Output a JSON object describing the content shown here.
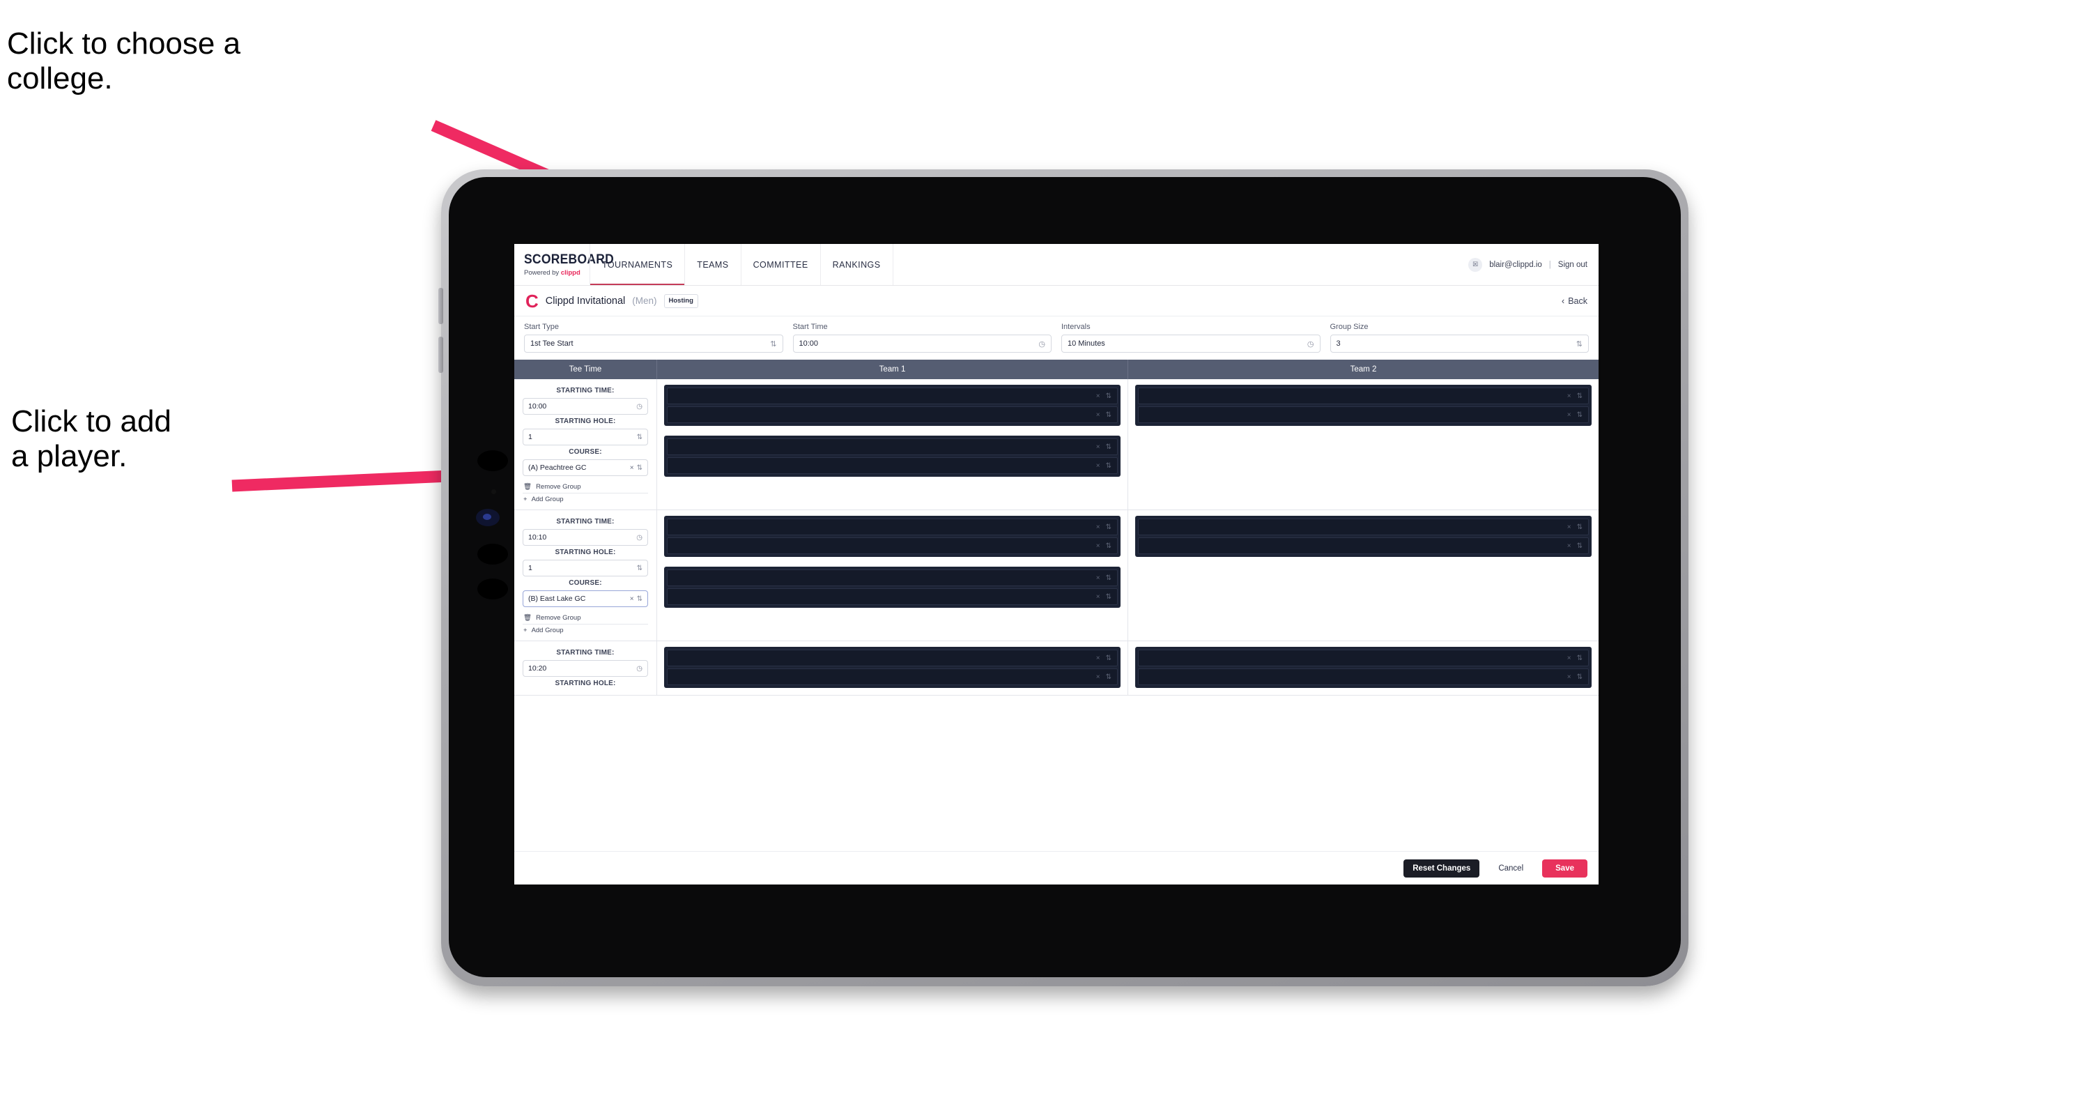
{
  "annotations": {
    "choose_college": "Click to choose a\ncollege.",
    "add_player": "Click to add\na player."
  },
  "colors": {
    "accent_pink": "#e8325c",
    "annotation_arrow": "#ef2a62",
    "table_header_bg": "#555d72",
    "panel_dark": "#1c2335"
  },
  "topnav": {
    "brand_name": "SCOREBOARD",
    "brand_sub_prefix": "Powered by ",
    "brand_sub_strong": "clippd",
    "items": [
      {
        "label": "TOURNAMENTS",
        "active": true
      },
      {
        "label": "TEAMS",
        "active": false
      },
      {
        "label": "COMMITTEE",
        "active": false
      },
      {
        "label": "RANKINGS",
        "active": false
      }
    ],
    "avatar_glyph": "☒",
    "email": "blair@clippd.io",
    "separator": "|",
    "sign_out": "Sign out"
  },
  "titlebar": {
    "logo_letter": "C",
    "tournament_name": "Clippd Invitational",
    "gender": "(Men)",
    "badge": "Hosting",
    "back_chevron": "‹",
    "back_label": "Back"
  },
  "controls": [
    {
      "label": "Start Type",
      "value": "1st Tee Start",
      "icon": "stepper-icon"
    },
    {
      "label": "Start Time",
      "value": "10:00",
      "icon": "clock-icon"
    },
    {
      "label": "Intervals",
      "value": "10 Minutes",
      "icon": "clock-icon"
    },
    {
      "label": "Group Size",
      "value": "3",
      "icon": "stepper-icon"
    }
  ],
  "table": {
    "headers": {
      "tee_time": "Tee Time",
      "team1": "Team 1",
      "team2": "Team 2"
    },
    "labels": {
      "starting_time": "STARTING TIME:",
      "starting_hole": "STARTING HOLE:",
      "course": "COURSE:",
      "remove_group": "Remove Group",
      "add_group": "Add Group"
    },
    "glyphs": {
      "clock": "◷",
      "stepper": "⇅",
      "clear": "×",
      "trash": "Ὕ1",
      "plus": "+"
    },
    "groups": [
      {
        "starting_time": "10:00",
        "starting_hole": "1",
        "course": "(A) Peachtree GC",
        "course_focused": false,
        "team1_panels": [
          {
            "slots": 2
          },
          {
            "slots": 2
          }
        ],
        "team2_panels": [
          {
            "slots": 2
          }
        ]
      },
      {
        "starting_time": "10:10",
        "starting_hole": "1",
        "course": "(B) East Lake GC",
        "course_focused": true,
        "team1_panels": [
          {
            "slots": 2
          },
          {
            "slots": 2
          }
        ],
        "team2_panels": [
          {
            "slots": 2
          }
        ]
      },
      {
        "starting_time": "10:20",
        "starting_hole": "",
        "course": "",
        "course_focused": false,
        "team1_panels": [
          {
            "slots": 2
          }
        ],
        "team2_panels": [
          {
            "slots": 2
          }
        ]
      }
    ]
  },
  "footer": {
    "reset": "Reset Changes",
    "cancel": "Cancel",
    "save": "Save"
  }
}
